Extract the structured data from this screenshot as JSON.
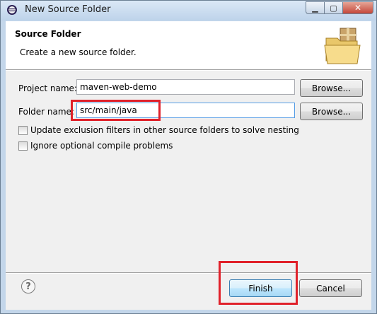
{
  "window": {
    "title": "New Source Folder",
    "icon": "eclipse-icon",
    "caption_buttons": {
      "minimize": "▁",
      "maximize": "▢",
      "close": "✕"
    }
  },
  "banner": {
    "title": "Source Folder",
    "description": "Create a new source folder.",
    "icon": "source-folder-wizard-icon"
  },
  "form": {
    "project_name_label": "Project name:",
    "project_name_value": "maven-web-demo",
    "folder_name_label": "Folder name:",
    "folder_name_value": "src/main/java",
    "browse_label": "Browse...",
    "update_exclusion_label": "Update exclusion filters in other source folders to solve nesting",
    "update_exclusion_checked": false,
    "ignore_optional_label": "Ignore optional compile problems",
    "ignore_optional_checked": false
  },
  "footer": {
    "help_icon": "help-icon",
    "help_glyph": "?",
    "finish_label": "Finish",
    "cancel_label": "Cancel"
  },
  "colors": {
    "highlight": "#e0212a",
    "banner_bg": "#ffffff",
    "dialog_bg": "#f0f0f0"
  }
}
